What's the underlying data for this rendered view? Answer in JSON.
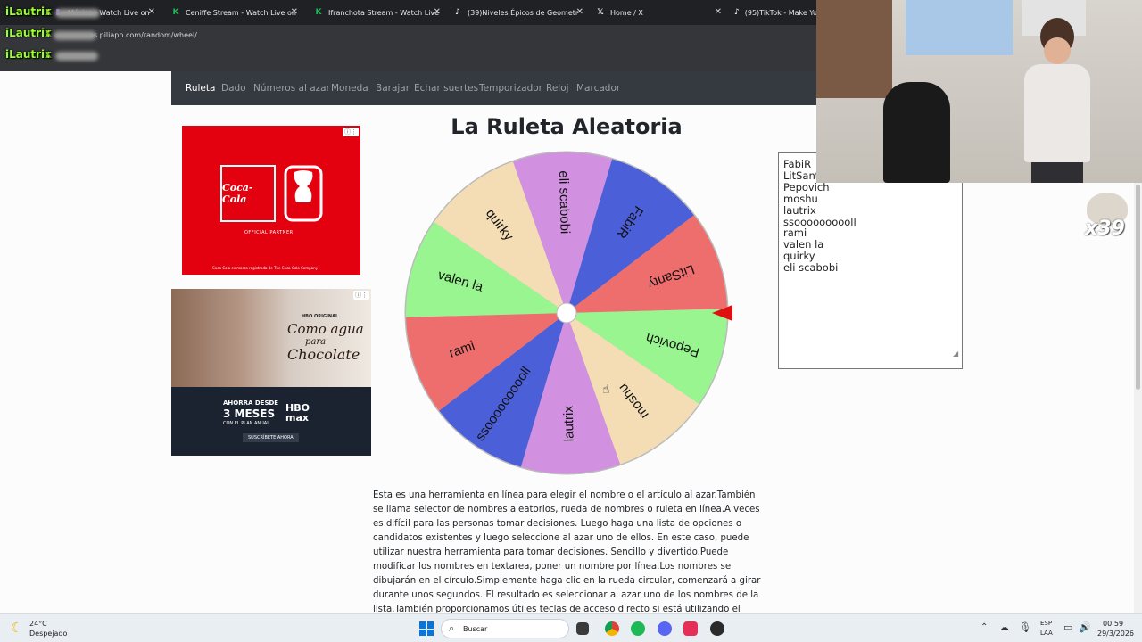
{
  "browser": {
    "tabs": [
      {
        "label": "Música · Watch Live on",
        "icon": "twitch-icon"
      },
      {
        "label": "Ceniffe Stream - Watch Live on",
        "icon": "kick-icon"
      },
      {
        "label": "Ifranchota Stream - Watch Live",
        "icon": "kick-icon"
      },
      {
        "label": "(39)Niveles Épicos de Geometr",
        "icon": "tiktok-icon"
      },
      {
        "label": "Home / X",
        "icon": "x-icon"
      },
      {
        "label": "(95)TikTok - Make You",
        "icon": "tiktok-icon"
      }
    ],
    "url": "es.piliapp.com/random/wheel/"
  },
  "chat": {
    "username": "iLautrix",
    "separator": ":"
  },
  "nav": {
    "items": [
      "Ruleta",
      "Dado",
      "Números al azar",
      "Moneda",
      "Barajar",
      "Echar suertes",
      "Temporizador",
      "Reloj",
      "Marcador"
    ]
  },
  "ads": {
    "coke": {
      "brand": "Coca-Cola",
      "partner": "OFFICIAL PARTNER",
      "fifa": "FIFA",
      "legal": "Coca-Cola es marca registrada de The Coca-Cola Company"
    },
    "hbo": {
      "tag": "HBO ORIGINAL",
      "title_line1": "Como agua",
      "title_line2": "para",
      "title_line3": "Chocolate",
      "offer_line1": "AHORRA DESDE",
      "offer_line2": "3 MESES",
      "offer_line3": "CON EL PLAN ANUAL",
      "brand": "HBO max",
      "cta": "SUSCRÍBETE AHORA"
    }
  },
  "page": {
    "title": "La Ruleta Aleatoria",
    "description": "Esta es una herramienta en línea para elegir el nombre o el artículo al azar.También se llama selector de nombres aleatorios, rueda de nombres o ruleta en línea.A veces es difícil para las personas tomar decisiones. Luego haga una lista de opciones o candidatos existentes y luego seleccione al azar uno de ellos. En este caso, puede utilizar nuestra herramienta para tomar decisiones. Sencillo y divertido.Puede modificar los nombres en textarea, poner un nombre por línea.Los nombres se dibujarán en el círculo.Simplemente haga clic en la rueda circular, comenzará a girar durante unos segundos. El resultado es seleccionar al azar uno de los nombres de la lista.También proporcionamos útiles teclas de acceso directo si está utilizando el escritorio."
  },
  "names_textarea": [
    "FabiR",
    "LitSanty",
    "Pepovich",
    "moshu",
    "lautrix",
    "ssoooooooooll",
    "rami",
    "valen la",
    "quirky",
    "eli scabobi"
  ],
  "wheel": {
    "segments": [
      {
        "label": "eli scabobi",
        "color": "#d291e0"
      },
      {
        "label": "FabiR",
        "color": "#4b5fd8"
      },
      {
        "label": "LitSanty",
        "color": "#ee6d6d"
      },
      {
        "label": "Pepovich",
        "color": "#98f58f"
      },
      {
        "label": "moshu",
        "color": "#f4ddb4"
      },
      {
        "label": "lautrix",
        "color": "#d291e0"
      },
      {
        "label": "ssoooooooooll",
        "color": "#4b5fd8"
      },
      {
        "label": "rami",
        "color": "#ee6d6d"
      },
      {
        "label": "valen la",
        "color": "#98f58f"
      },
      {
        "label": "quirky",
        "color": "#f4ddb4"
      }
    ]
  },
  "overlay": {
    "counter": "x39"
  },
  "taskbar": {
    "weather_temp": "24°C",
    "weather_desc": "Despejado",
    "search_placeholder": "Buscar",
    "lang_line1": "ESP",
    "lang_line2": "LAA",
    "time": "00:59",
    "date": "29/3/2026"
  }
}
